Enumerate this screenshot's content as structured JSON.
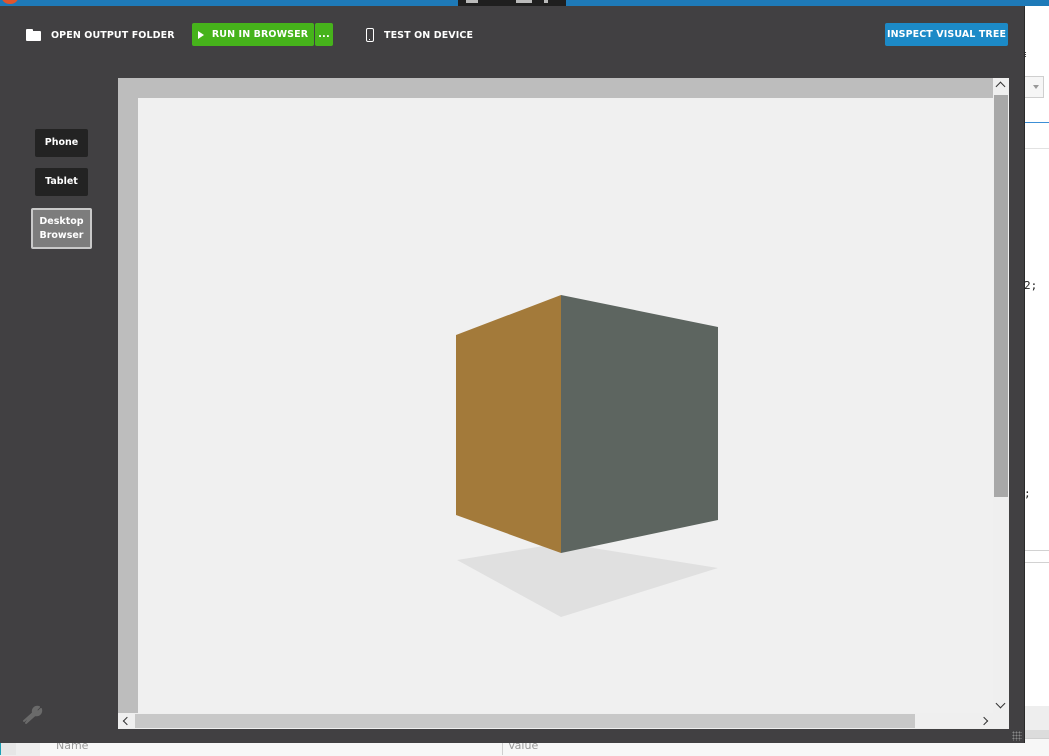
{
  "toolbar": {
    "open_output_folder": "OPEN OUTPUT FOLDER",
    "run_in_browser": "RUN IN BROWSER",
    "more_options": "...",
    "test_on_device": "TEST ON DEVICE",
    "inspect_visual_tree": "INSPECT VISUAL TREE"
  },
  "device_selector": {
    "phone": "Phone",
    "tablet": "Tablet",
    "desktop_line1": "Desktop",
    "desktop_line2": "Browser",
    "selected": "Desktop Browser"
  },
  "colors": {
    "window_bg": "#414042",
    "run_button": "#46b31b",
    "inspect_button": "#1c8ac7",
    "cube_left_face": "#a37a3a",
    "cube_right_face": "#5d6560",
    "shadow": "#e0e0e0",
    "canvas_bg": "#f0f0f0"
  },
  "icons": {
    "open_output_folder": "folder-icon",
    "run_in_browser": "play-icon",
    "test_on_device": "phone-icon",
    "settings": "wrench-icon"
  },
  "background_ide": {
    "code_fragment_1": "2;",
    "code_fragment_2": ";",
    "property_name_header": "Name",
    "property_value_header": "Value"
  }
}
